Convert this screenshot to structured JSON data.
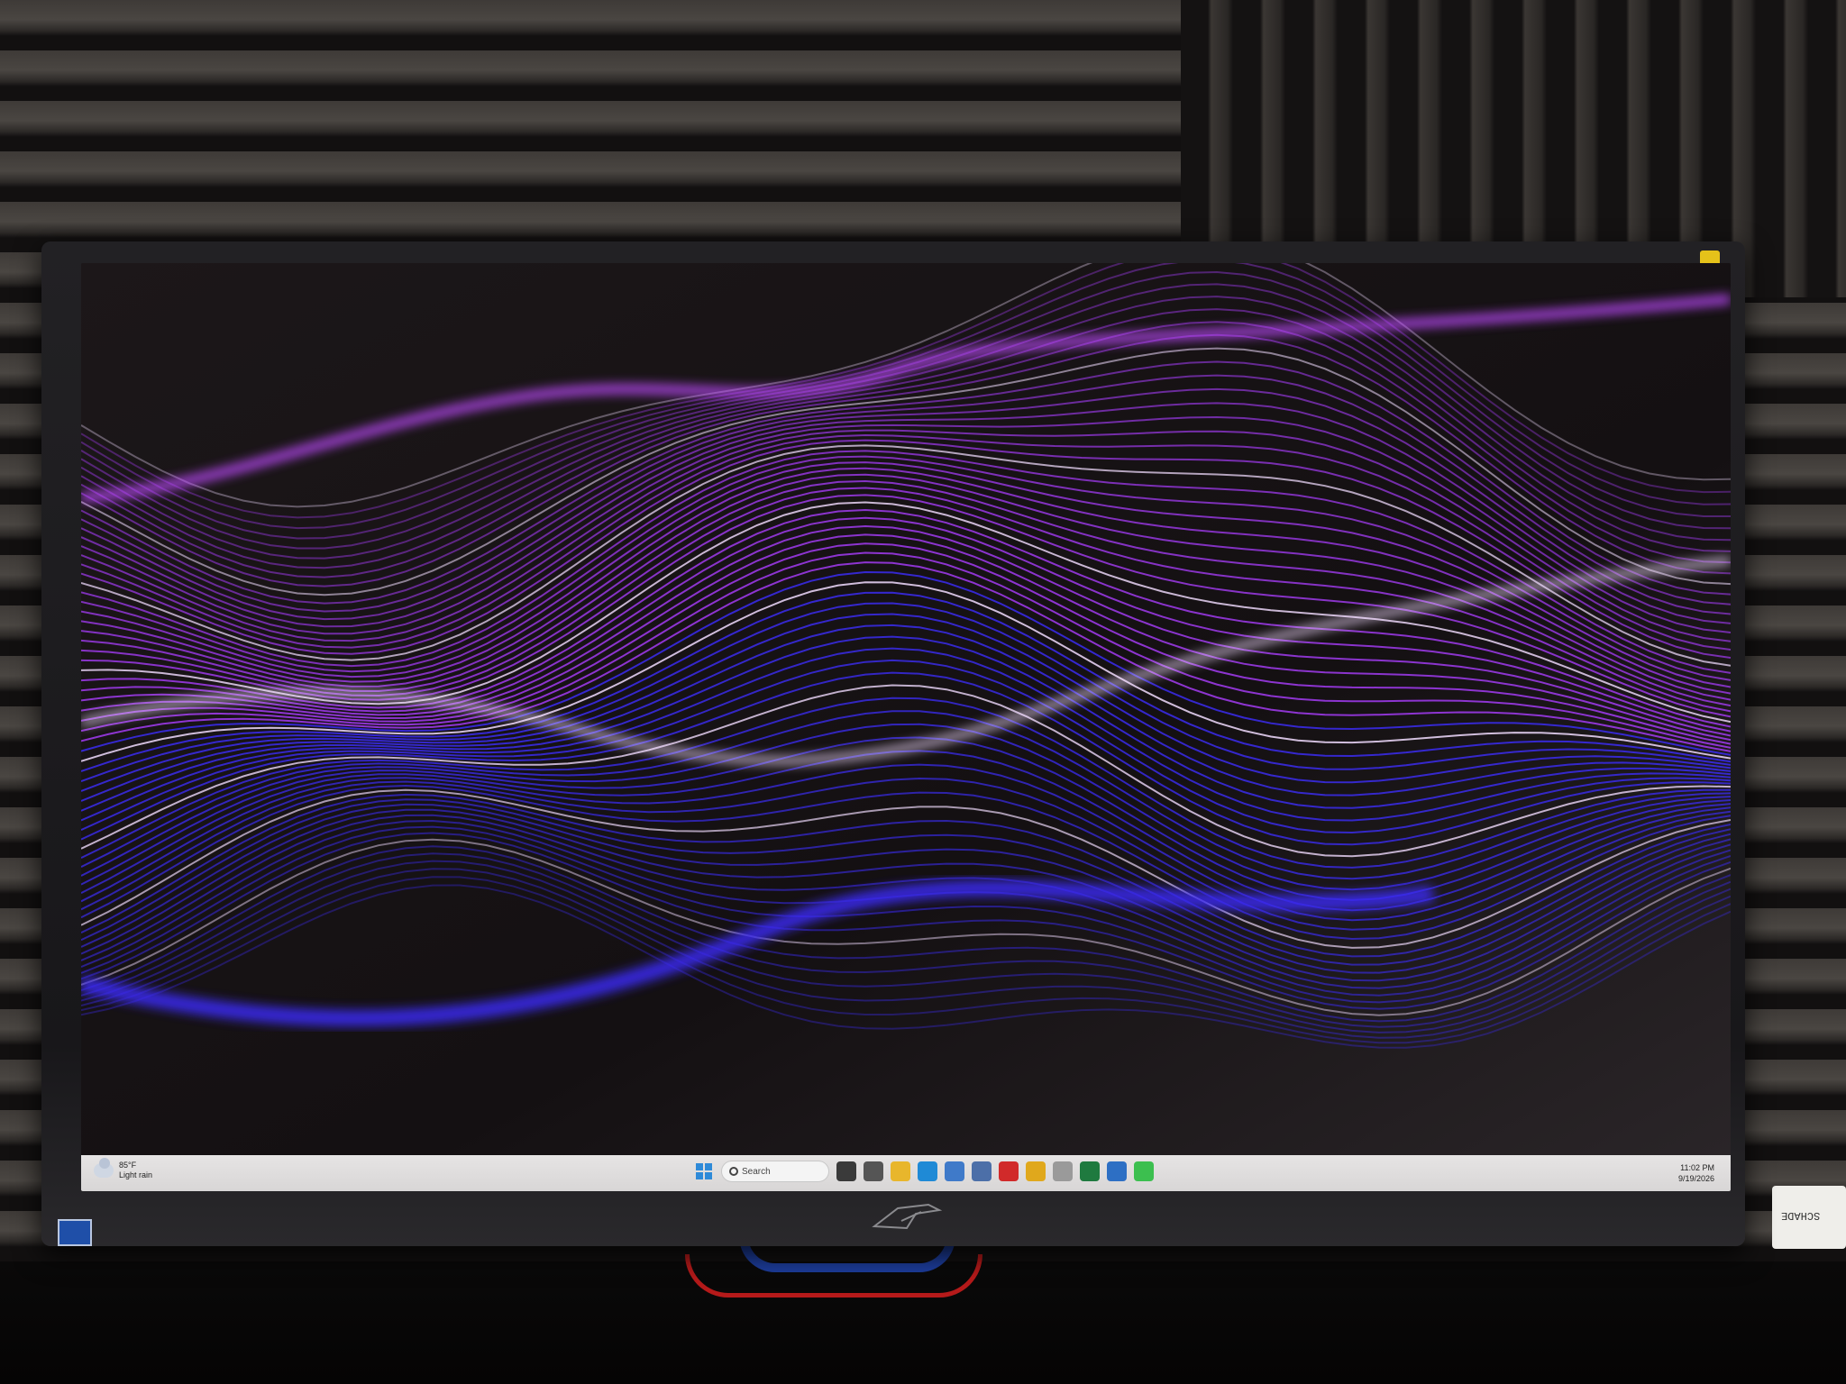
{
  "taskbar": {
    "weather": {
      "temp": "85°F",
      "condition": "Light rain",
      "icon": "cloud-rain-icon"
    },
    "search_placeholder": "Search",
    "pinned_apps": [
      {
        "name": "task-view-icon",
        "color": "#3a3a3a"
      },
      {
        "name": "settings-gear-icon",
        "color": "#555555"
      },
      {
        "name": "file-explorer-icon",
        "color": "#e8b62c"
      },
      {
        "name": "edge-browser-icon",
        "color": "#1f8ad6"
      },
      {
        "name": "notepad-icon",
        "color": "#3f7ac9"
      },
      {
        "name": "document-icon",
        "color": "#4c6fa8"
      },
      {
        "name": "opera-icon",
        "color": "#d12a2a"
      },
      {
        "name": "chrome-icon",
        "color": "#e0a81c"
      },
      {
        "name": "paint-icon",
        "color": "#9a9a9a"
      },
      {
        "name": "excel-icon",
        "color": "#1f7a3f"
      },
      {
        "name": "remote-desktop-icon",
        "color": "#2d6fc4"
      },
      {
        "name": "android-icon",
        "color": "#3cbf4f"
      }
    ],
    "clock": {
      "time": "11:02 PM",
      "date": "9/19/2026"
    }
  },
  "monitor": {
    "brand_logo": "rog-eye-logo"
  },
  "colors": {
    "wave_purple": "#a23bf2",
    "wave_blue": "#3b2cf0",
    "wave_highlight": "#f1dcff"
  }
}
